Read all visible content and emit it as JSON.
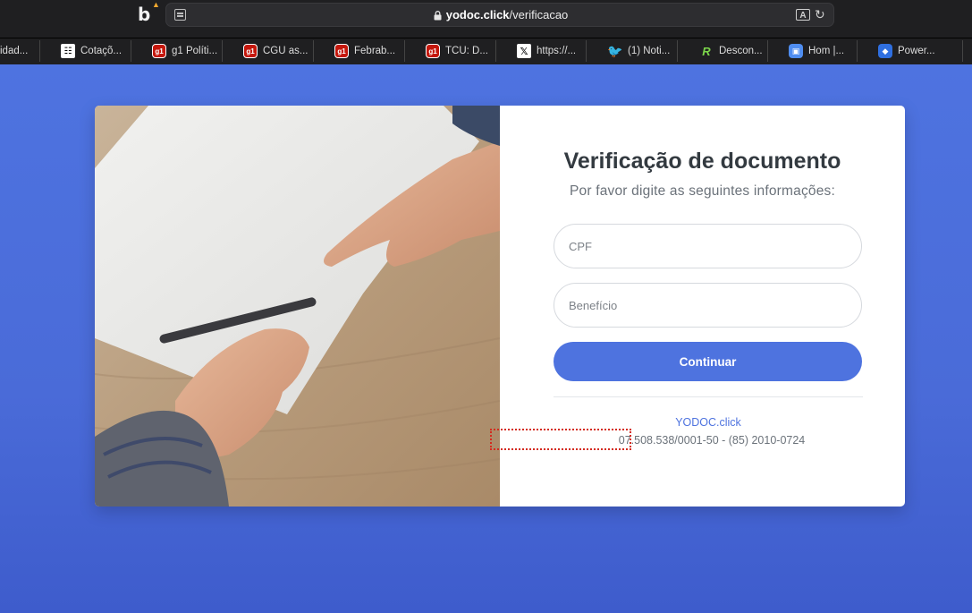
{
  "browser": {
    "url_host": "yodoc.click",
    "url_path": "/verificacao"
  },
  "bookmarks": [
    {
      "label": "idad...",
      "icon": "none"
    },
    {
      "label": "Cotaçõ...",
      "icon": "cotacao-icon"
    },
    {
      "label": "g1 Políti...",
      "icon": "g1-icon"
    },
    {
      "label": "CGU as...",
      "icon": "g1-icon"
    },
    {
      "label": "Febrab...",
      "icon": "g1-icon"
    },
    {
      "label": "TCU: D...",
      "icon": "g1-icon"
    },
    {
      "label": "https://...",
      "icon": "x-icon"
    },
    {
      "label": "(1) Noti...",
      "icon": "twitter-icon"
    },
    {
      "label": "Descon...",
      "icon": "r-icon"
    },
    {
      "label": "Hom |...",
      "icon": "hom-icon"
    },
    {
      "label": "Power...",
      "icon": "power-icon"
    }
  ],
  "form": {
    "title": "Verificação de documento",
    "subtitle": "Por favor digite as seguintes informações:",
    "cpf_placeholder": "CPF",
    "beneficio_placeholder": "Benefício",
    "submit_label": "Continuar"
  },
  "footer": {
    "site_name": "YODOC.click",
    "info": "07.508.538/0001-50 - (85) 2010-0724"
  },
  "colors": {
    "accent": "#4e73df",
    "background": "#4a6fdc",
    "highlight": "#d42a1e"
  }
}
